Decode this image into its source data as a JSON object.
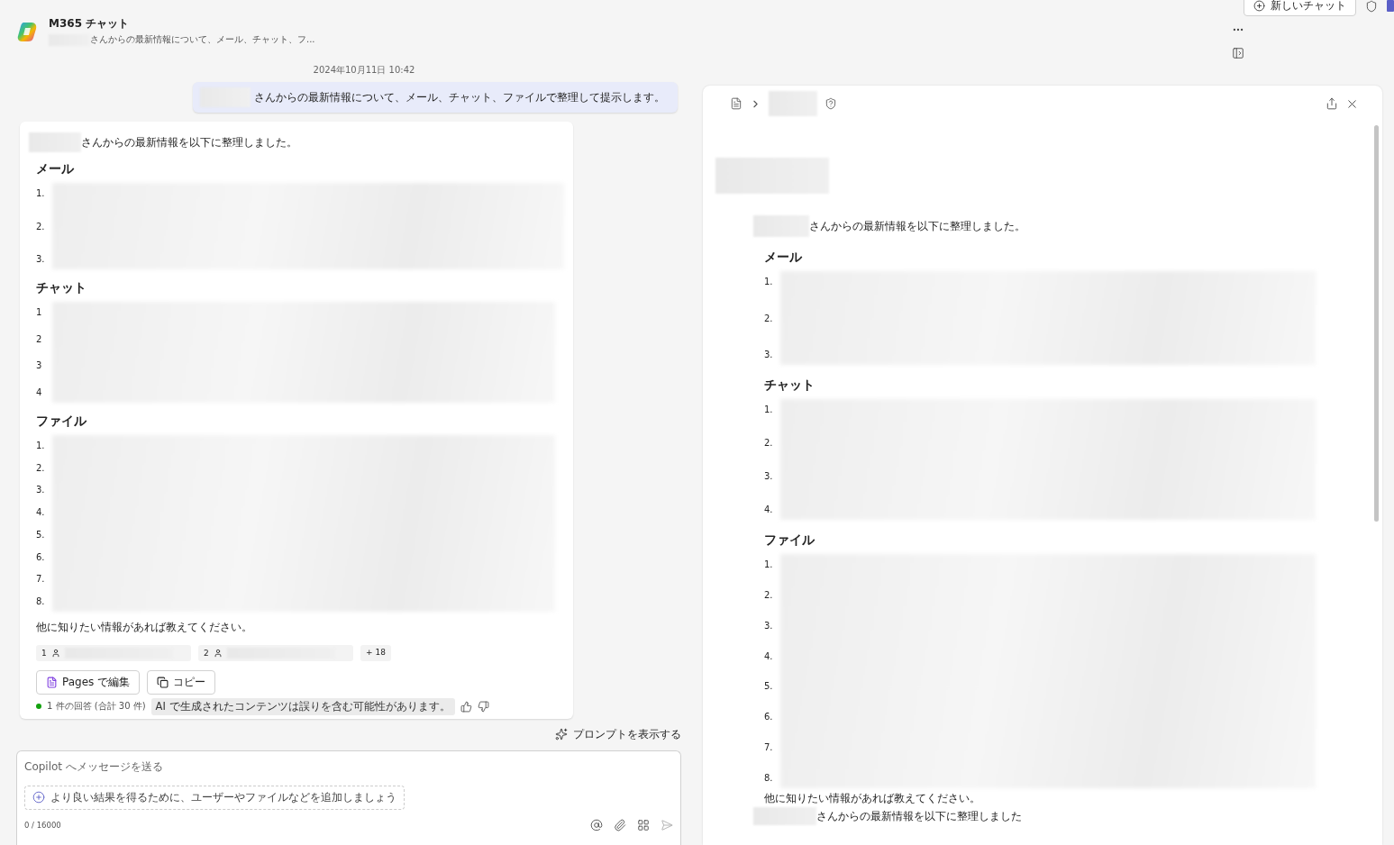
{
  "app": {
    "title": "M365 チャット",
    "subtitle": "さんからの最新情報について、メール、チャット、フ..."
  },
  "top_actions": {
    "new_chat": "新しいチャット"
  },
  "timestamp": "2024年10月11日 10:42",
  "user_message": "さんからの最新情報について、メール、チャット、ファイルで整理して提示します。",
  "response": {
    "intro": "さんからの最新情報を以下に整理しました。",
    "sections": [
      {
        "heading": "メール",
        "numbers": [
          "1.",
          "2.",
          "3."
        ]
      },
      {
        "heading": "チャット",
        "numbers": [
          "1",
          "2",
          "3",
          "4"
        ]
      },
      {
        "heading": "ファイル",
        "numbers": [
          "1.",
          "2.",
          "3.",
          "4.",
          "5.",
          "6.",
          "7.",
          "8."
        ]
      }
    ],
    "closing": "他に知りたい情報があれば教えてください。",
    "citations": [
      {
        "number": "1"
      },
      {
        "number": "2"
      }
    ],
    "more_citations": "+ 18",
    "actions": [
      {
        "kind": "pages",
        "label": "Pages で編集"
      },
      {
        "kind": "copy",
        "label": "コピー"
      }
    ],
    "answer_count": "1 件の回答 (合計 30 件)",
    "disclaimer": "AI で生成されたコンテンツは誤りを含む可能性があります。"
  },
  "show_prompt": "プロンプトを表示する",
  "composer": {
    "placeholder": "Copilot へメッセージを送る",
    "suggestion": "より良い結果を得るために、ユーザーやファイルなどを追加しましょう",
    "counter": "0 / 16000"
  },
  "page_panel": {
    "intro": "さんからの最新情報を以下に整理しました。",
    "sections": [
      {
        "heading": "メール",
        "numbers": [
          "1.",
          "2.",
          "3."
        ]
      },
      {
        "heading": "チャット",
        "numbers": [
          "1.",
          "2.",
          "3.",
          "4."
        ]
      },
      {
        "heading": "ファイル",
        "numbers": [
          "1.",
          "2.",
          "3.",
          "4.",
          "5.",
          "6.",
          "7.",
          "8."
        ]
      }
    ],
    "closing": "他に知りたい情報があれば教えてください。",
    "trailing": "さんからの最新情報を以下に整理しました"
  }
}
